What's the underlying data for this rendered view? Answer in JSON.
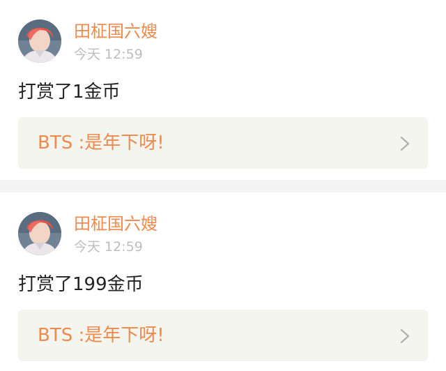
{
  "posts": [
    {
      "user": "田柾国六嫂",
      "time": "今天 12:59",
      "text": "打赏了1金币",
      "link": "BTS :是年下呀!",
      "avatar_icon": "user-avatar",
      "chevron_icon": "chevron-right-icon"
    },
    {
      "user": "田柾国六嫂",
      "time": "今天 12:59",
      "text": "打赏了199金币",
      "link": "BTS :是年下呀!",
      "avatar_icon": "user-avatar",
      "chevron_icon": "chevron-right-icon"
    }
  ],
  "colors": {
    "accent": "#ee8a4c",
    "time": "#bdbdbd",
    "text": "#222222",
    "link_bg": "#f5f5f0",
    "separator": "#f4f4f4"
  }
}
